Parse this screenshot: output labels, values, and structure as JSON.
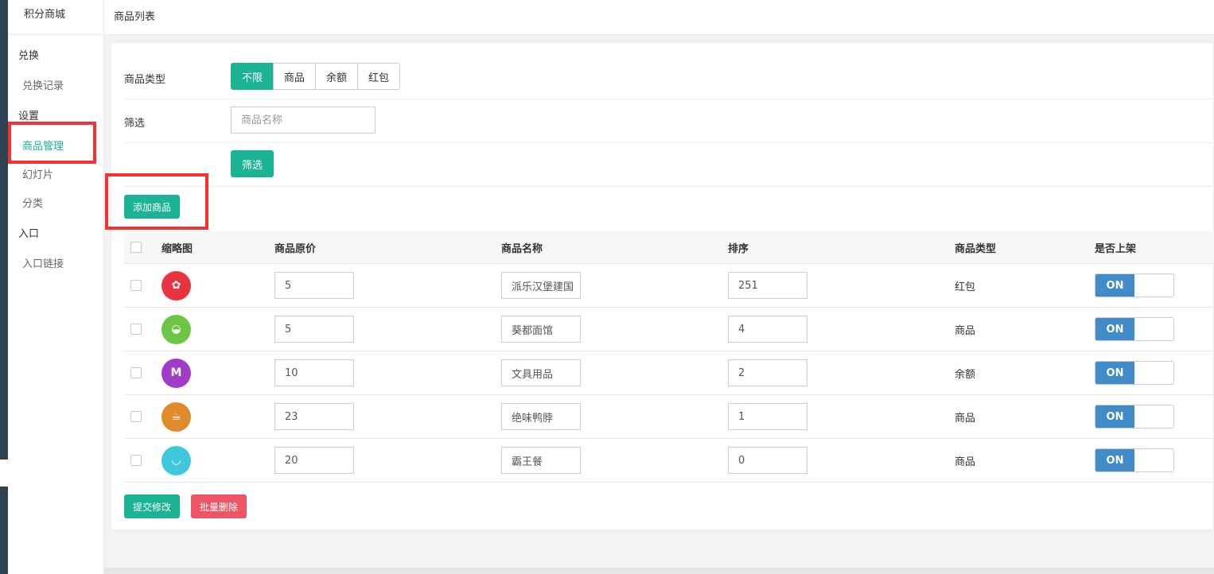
{
  "sidebar": {
    "brand": "积分商城",
    "sections": [
      {
        "label": "兑换",
        "items": [
          "兑换记录"
        ]
      },
      {
        "label": "设置",
        "items": [
          "商品管理",
          "幻灯片",
          "分类"
        ]
      },
      {
        "label": "入口",
        "items": [
          "入口链接"
        ]
      }
    ],
    "active_item": "商品管理"
  },
  "header": {
    "title": "商品列表"
  },
  "filters": {
    "type_label": "商品类型",
    "type_options": [
      "不限",
      "商品",
      "余额",
      "红包"
    ],
    "type_selected": "不限",
    "filter_label": "筛选",
    "search_placeholder": "商品名称",
    "filter_button": "筛选"
  },
  "actions": {
    "add": "添加商品",
    "submit": "提交修改",
    "batch_delete": "批量删除"
  },
  "table": {
    "headers": [
      "缩略图",
      "商品原价",
      "商品名称",
      "排序",
      "商品类型",
      "是否上架"
    ],
    "rows": [
      {
        "icon": "cookie-icon",
        "color": "#e8343f",
        "price": "5",
        "name": "派乐汉堡建国",
        "sort": "251",
        "type": "红包",
        "status": "ON"
      },
      {
        "icon": "melon-icon",
        "color": "#6cc644",
        "price": "5",
        "name": "葵都面馆",
        "sort": "4",
        "type": "商品",
        "status": "ON"
      },
      {
        "icon": "m-cup-icon",
        "color": "#a13cc9",
        "price": "10",
        "name": "文具用品",
        "sort": "2",
        "type": "余额",
        "status": "ON"
      },
      {
        "icon": "coffee-icon",
        "color": "#e08a2c",
        "price": "23",
        "name": "绝味鸭脖",
        "sort": "1",
        "type": "商品",
        "status": "ON"
      },
      {
        "icon": "noodle-bowl-icon",
        "color": "#3fc8dc",
        "price": "20",
        "name": "霸王餐",
        "sort": "0",
        "type": "商品",
        "status": "ON"
      }
    ]
  },
  "colors": {
    "primary": "#1ab394",
    "danger": "#ed5565",
    "toggle": "#428bca",
    "highlight": "#f43232"
  }
}
